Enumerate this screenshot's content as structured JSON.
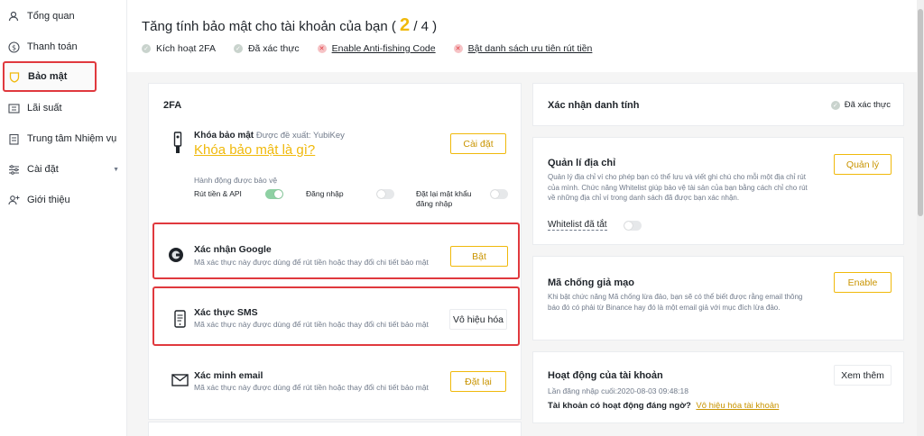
{
  "sidebar": {
    "items": [
      {
        "label": "Tổng quan",
        "icon": "user-icon"
      },
      {
        "label": "Thanh toán",
        "icon": "dollar-icon"
      },
      {
        "label": "Bảo mật",
        "icon": "shield-icon"
      },
      {
        "label": "Lãi suất",
        "icon": "ticket-icon"
      },
      {
        "label": "Trung tâm Nhiệm vụ",
        "icon": "task-icon"
      },
      {
        "label": "Cài đặt",
        "icon": "settings-icon"
      },
      {
        "label": "Giới thiệu",
        "icon": "add-user-icon"
      }
    ]
  },
  "header": {
    "title_prefix": "Tăng tính bảo mật cho tài khoản của bạn (",
    "progress_current": "2",
    "progress_rest": " / 4 )",
    "checks": [
      {
        "label": "Kích hoạt 2FA",
        "done": true
      },
      {
        "label": "Đã xác thực",
        "done": true
      },
      {
        "label": "Enable Anti-fishing Code",
        "done": false
      },
      {
        "label": "Bật danh sách ưu tiên rút tiền",
        "done": false
      }
    ]
  },
  "twofa": {
    "title": "2FA",
    "security_key": {
      "title": "Khóa bảo mật",
      "recommend": "Được đề xuất: YubiKey",
      "link": "Khóa bảo mật là gì?",
      "button": "Cài đặt",
      "protected_label": "Hành động được bảo vệ",
      "actions": [
        {
          "label": "Rút tiền & API",
          "on": true
        },
        {
          "label": "Đăng nhập",
          "on": false
        },
        {
          "label": "Đặt lại mật khẩu đăng nhập",
          "on": false
        }
      ]
    },
    "google": {
      "title": "Xác nhận Google",
      "desc": "Mã xác thực này được dùng để rút tiền hoặc thay đổi chi tiết bảo mật",
      "button": "Bật"
    },
    "sms": {
      "title": "Xác thực SMS",
      "desc": "Mã xác thực này được dùng để rút tiền hoặc thay đổi chi tiết bảo mật",
      "button": "Vô hiệu hóa"
    },
    "email": {
      "title": "Xác minh email",
      "desc": "Mã xác thực này được dùng để rút tiền hoặc thay đổi chi tiết bảo mật",
      "button": "Đặt lại"
    }
  },
  "identity": {
    "title": "Xác nhận danh tính",
    "status": "Đã xác thực"
  },
  "address": {
    "title": "Quản lí địa chỉ",
    "desc": "Quản lý địa chỉ ví cho phép bạn có thể lưu và viết ghi chú cho mỗi một địa chỉ rút của mình. Chức năng Whitelist giúp bảo vệ tài sản của bạn bằng cách chỉ cho rút về những địa chỉ ví trong danh sách đã được bạn xác nhận.",
    "button": "Quản lý",
    "whitelist_label": "Whitelist đã tắt"
  },
  "antiphishing": {
    "title": "Mã chống giả mạo",
    "desc": "Khi bật chức năng Mã chống lừa đảo, bạn sẽ có thể biết được rằng email thông báo đó có phải từ Binance hay đó là một email giả với mục đích lừa đảo.",
    "button": "Enable"
  },
  "activity": {
    "title": "Hoạt động của tài khoản",
    "last_login": "Lần đăng nhập cuối:2020-08-03 09:48:18",
    "question": "Tài khoản có hoạt động đáng ngờ?",
    "disable_link": "Vô hiệu hóa tài khoản",
    "button": "Xem thêm"
  }
}
